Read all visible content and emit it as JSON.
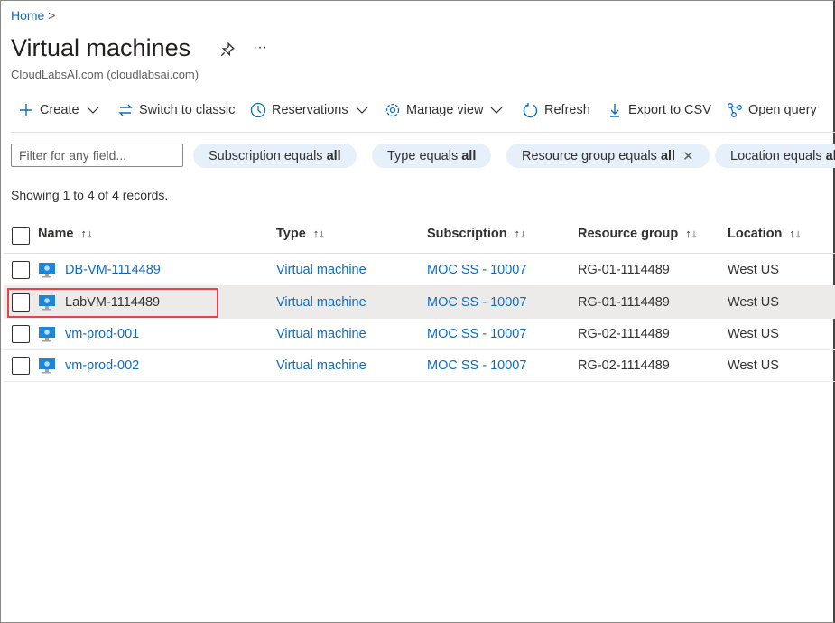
{
  "breadcrumb": {
    "home": "Home",
    "sep": ">"
  },
  "page": {
    "title": "Virtual machines",
    "subtitle": "CloudLabsAI.com (cloudlabsai.com)",
    "pin_icon": "pin-icon",
    "more": "···"
  },
  "toolbar": [
    {
      "label": "Create",
      "icon": "plus-icon",
      "chev": true
    },
    {
      "label": "Switch to classic",
      "icon": "switch-icon",
      "chev": false
    },
    {
      "label": "Reservations",
      "icon": "clock-icon",
      "chev": true
    },
    {
      "label": "Manage view",
      "icon": "gear-icon",
      "chev": true
    },
    {
      "label": "Refresh",
      "icon": "refresh-icon",
      "chev": false
    },
    {
      "label": "Export to CSV",
      "icon": "download-icon",
      "chev": false
    },
    {
      "label": "Open query",
      "icon": "query-icon",
      "chev": false
    }
  ],
  "filter": {
    "placeholder": "Filter for any field..."
  },
  "pills": [
    {
      "key": "Subscription equals ",
      "val": "all"
    },
    {
      "key": "Type equals ",
      "val": "all"
    },
    {
      "key": "Resource group equals ",
      "val": "all",
      "close": "✕"
    },
    {
      "key": "Location equals ",
      "val": "all"
    }
  ],
  "showing": "Showing 1 to 4 of 4 records.",
  "columns": [
    "Name",
    "Type",
    "Subscription",
    "Resource group",
    "Location"
  ],
  "sort_glyph": "↑↓",
  "rows": [
    {
      "name": "DB-VM-1114489",
      "type": "Virtual machine",
      "subscription": "MOC SS - 10007",
      "rg": "RG-01-1114489",
      "location": "West US",
      "selected": false
    },
    {
      "name": "LabVM-1114489",
      "type": "Virtual machine",
      "subscription": "MOC SS - 10007",
      "rg": "RG-01-1114489",
      "location": "West US",
      "selected": true
    },
    {
      "name": "vm-prod-001",
      "type": "Virtual machine",
      "subscription": "MOC SS - 10007",
      "rg": "RG-02-1114489",
      "location": "West US",
      "selected": false
    },
    {
      "name": "vm-prod-002",
      "type": "Virtual machine",
      "subscription": "MOC SS - 10007",
      "rg": "RG-02-1114489",
      "location": "West US",
      "selected": false
    }
  ],
  "colors": {
    "link": "#0f6cbd",
    "highlight": "#e8434a",
    "pill": "#e6f0fb"
  }
}
